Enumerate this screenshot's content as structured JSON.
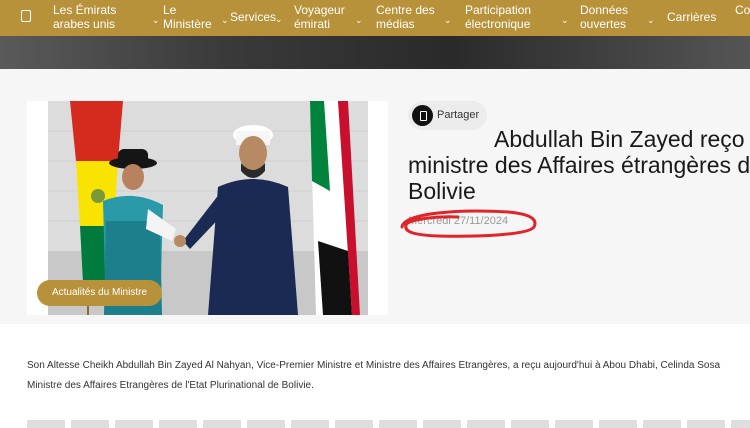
{
  "nav": {
    "items": [
      {
        "label": "Les Émirats arabes unis",
        "line1": "Les Émirats",
        "line2": "arabes unis",
        "has_dropdown": true
      },
      {
        "label": "Le Ministère",
        "line1": "Le",
        "line2": "Ministère",
        "has_dropdown": true
      },
      {
        "label": "Services",
        "has_dropdown": true
      },
      {
        "label": "Voyageur émirati",
        "line1": "Voyageur",
        "line2": "émirati",
        "has_dropdown": true
      },
      {
        "label": "Centre des médias",
        "line1": "Centre des",
        "line2": "médias",
        "has_dropdown": true
      },
      {
        "label": "Participation électronique",
        "line1": "Participation",
        "line2": "électronique",
        "has_dropdown": true
      },
      {
        "label": "Données ouvertes",
        "line1": "Données",
        "line2": "ouvertes",
        "has_dropdown": true
      },
      {
        "label": "Carrières",
        "has_dropdown": false
      },
      {
        "label": "Co",
        "line1": "Co",
        "line2": "",
        "has_dropdown": false
      }
    ],
    "chevron": "⌄"
  },
  "colors": {
    "accent": "#b8923a",
    "title": "#1a1a1a",
    "date": "#9a9a9a",
    "annotation": "#e0252a"
  },
  "article": {
    "category": "Actualités du Ministre",
    "share_label": "Partager",
    "title_line1": "Abdullah Bin Zayed reço",
    "title_line2": "ministre des Affaires étrangères d",
    "title_line3": "Bolivie",
    "date": "Mercredi 27/11/2024",
    "paragraph1_line1": "Son Altesse Cheikh Abdullah Bin Zayed Al Nahyan, Vice-Premier Ministre et Ministre des Affaires Etrangères, a reçu aujourd'hui à Abou Dhabi, Celinda Sosa",
    "paragraph1_line2": "Ministre des Affaires Etrangères de l'Etat Plurinational de Bolivie."
  },
  "icons": {
    "home": "home-icon",
    "share": "share-icon"
  }
}
